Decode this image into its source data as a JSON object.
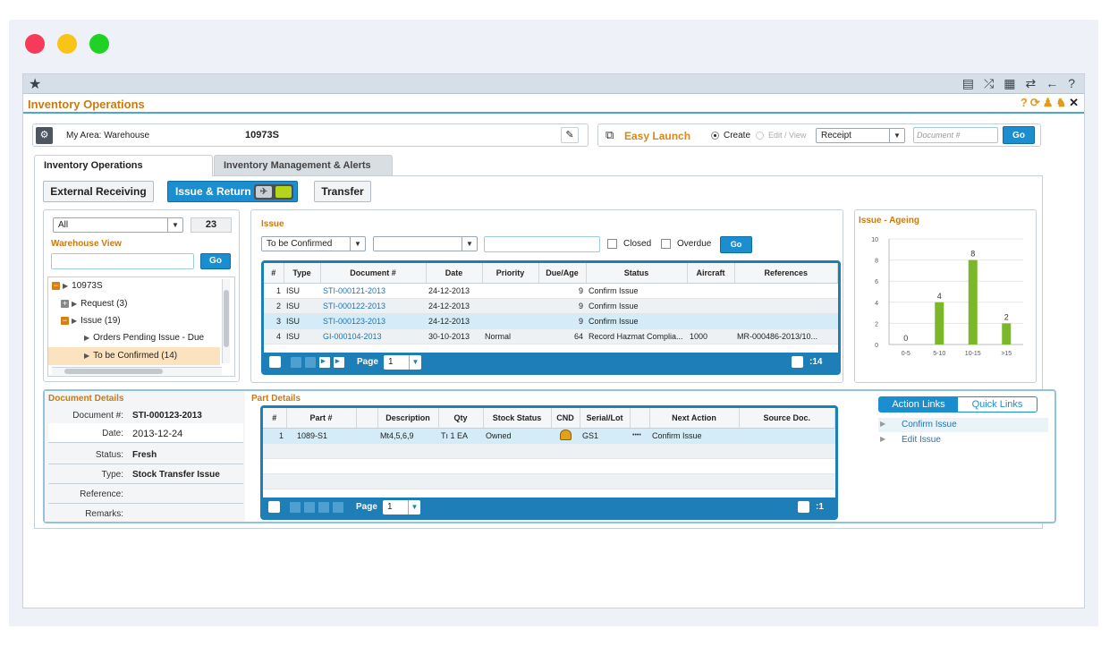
{
  "window": {
    "dot_colors": [
      "#f53b57",
      "#f9c416",
      "#1fd224"
    ]
  },
  "topbar": {
    "icons": [
      "star-icon",
      "report-icon",
      "shuffle-icon",
      "print-icon",
      "swap-icon",
      "back-arrow-icon",
      "help-icon"
    ],
    "star": "★",
    "help": "?"
  },
  "title": "Inventory Operations",
  "area": {
    "label": "My Area:  Warehouse",
    "id": "10973S"
  },
  "easy_launch": {
    "title": "Easy Launch",
    "create_label": "Create",
    "edit_label": "Edit / View",
    "doc_type": "Receipt",
    "doc_placeholder": "Document #",
    "go": "Go"
  },
  "tabs": [
    {
      "label": "Inventory Operations"
    },
    {
      "label": "Inventory Management & Alerts"
    }
  ],
  "subtabs": {
    "external": "External Receiving",
    "issue_return": "Issue & Return",
    "transfer": "Transfer"
  },
  "warehouse": {
    "filter": "All",
    "count": "23",
    "title": "Warehouse View",
    "go": "Go",
    "tree": {
      "root": "10973S",
      "request": "Request  (3)",
      "issue": "Issue  (19)",
      "orders_pending": "Orders Pending Issue - Due",
      "to_be_confirmed": "To be Confirmed  (14)"
    }
  },
  "issue": {
    "title": "Issue",
    "filter": "To be Confirmed",
    "closed": "Closed",
    "overdue": "Overdue",
    "go": "Go",
    "columns": [
      "#",
      "Type",
      "Document #",
      "Date",
      "Priority",
      "Due/Age",
      "Status",
      "Aircraft",
      "References"
    ],
    "rows": [
      {
        "n": "1",
        "type": "ISU",
        "doc": "STI-000121-2013",
        "date": "24-12-2013",
        "priority": "",
        "age": "9",
        "status": "Confirm Issue",
        "aircraft": "",
        "ref": ""
      },
      {
        "n": "2",
        "type": "ISU",
        "doc": "STI-000122-2013",
        "date": "24-12-2013",
        "priority": "",
        "age": "9",
        "status": "Confirm Issue",
        "aircraft": "",
        "ref": ""
      },
      {
        "n": "3",
        "type": "ISU",
        "doc": "STI-000123-2013",
        "date": "24-12-2013",
        "priority": "",
        "age": "9",
        "status": "Confirm Issue",
        "aircraft": "",
        "ref": ""
      },
      {
        "n": "4",
        "type": "ISU",
        "doc": "GI-000104-2013",
        "date": "30-10-2013",
        "priority": "Normal",
        "age": "64",
        "status": "Record Hazmat Complia...",
        "aircraft": "1000",
        "ref": "MR-000486-2013/10..."
      }
    ],
    "page_label": "Page",
    "page": "1",
    "total": ":14"
  },
  "ageing": {
    "title": "Issue - Ageing"
  },
  "chart_data": {
    "type": "bar",
    "categories": [
      "0-5",
      "5-10",
      "10-15",
      ">15"
    ],
    "values": [
      0,
      4,
      8,
      2
    ],
    "ylim": [
      0,
      10
    ],
    "yticks": [
      "0",
      "2",
      "4",
      "6",
      "8",
      "10"
    ],
    "bar_color": "#7ab82a",
    "grid": true
  },
  "doc_details": {
    "title": "Document Details",
    "fields": [
      {
        "label": "Document #:",
        "value": "STI-000123-2013"
      },
      {
        "label": "Date:",
        "value": "2013-12-24"
      },
      {
        "label": "Status:",
        "value": "Fresh"
      },
      {
        "label": "Type:",
        "value": "Stock Transfer Issue"
      },
      {
        "label": "Reference:",
        "value": ""
      },
      {
        "label": "Remarks:",
        "value": ""
      }
    ]
  },
  "part_details": {
    "title": "Part Details",
    "columns": [
      "#",
      "Part #",
      "",
      "Description",
      "Qty",
      "Stock Status",
      "CND",
      "Serial/Lot",
      "",
      "Next Action",
      "Source Doc."
    ],
    "rows": [
      {
        "n": "1",
        "part": "1089-S1",
        "desc": "Mt4,5,6,9",
        "t": "Tı",
        "qty": "1 EA",
        "stock": "Owned",
        "serial": "GS1",
        "dots": "••••",
        "next": "Confirm Issue",
        "source": ""
      }
    ],
    "page_label": "Page",
    "page": "1",
    "total": ":1"
  },
  "action_links": {
    "tab_action": "Action Links",
    "tab_quick": "Quick Links",
    "items": [
      "Confirm Issue",
      "Edit Issue"
    ]
  }
}
